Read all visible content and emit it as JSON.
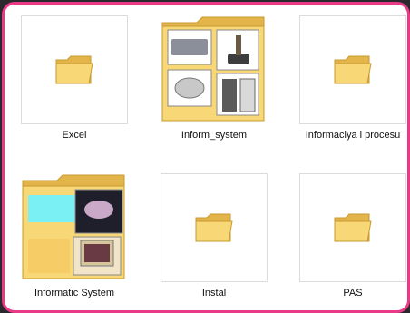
{
  "folders": [
    {
      "name": "Excel",
      "icon": "folder-icon"
    },
    {
      "name": "Inform_system",
      "icon": "folder-thumbnail-icon"
    },
    {
      "name": "Informaciya i procesu",
      "icon": "folder-icon"
    },
    {
      "name": "Informatic System",
      "icon": "folder-thumbnail-icon"
    },
    {
      "name": "Instal",
      "icon": "folder-icon"
    },
    {
      "name": "PAS",
      "icon": "folder-icon"
    }
  ],
  "colors": {
    "border_accent": "#e83a86",
    "folder_yellow": "#f8d776",
    "folder_dark": "#e2b44a"
  }
}
